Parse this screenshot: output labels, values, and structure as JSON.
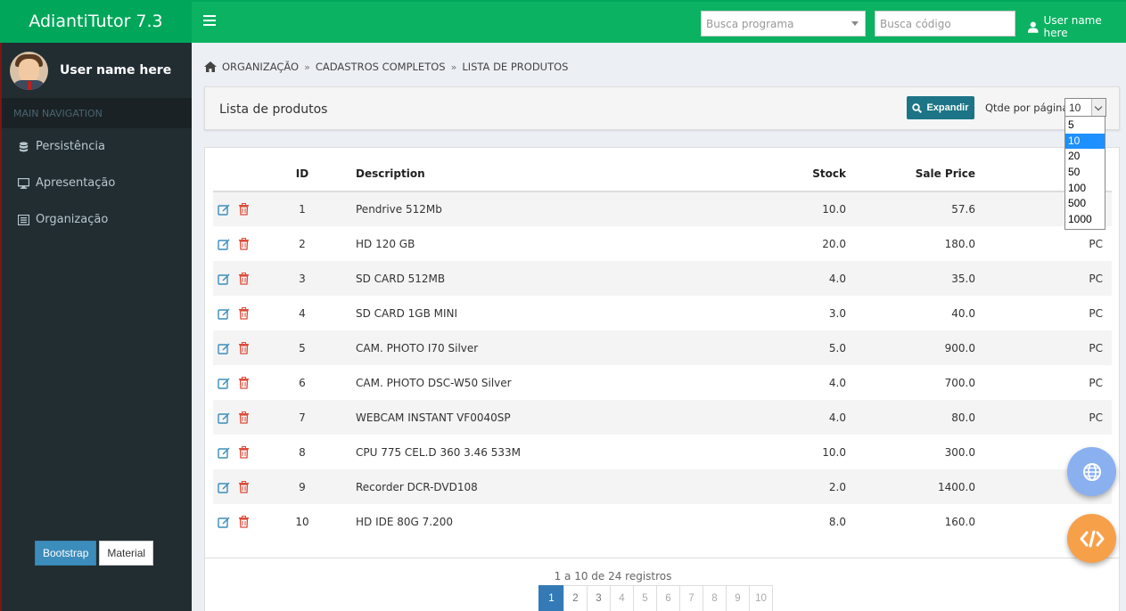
{
  "app": {
    "title": "AdiantiTutor 7.3"
  },
  "navbar": {
    "search_program_placeholder": "Busca programa",
    "search_code_placeholder": "Busca código",
    "user_name": "User name here"
  },
  "sidebar": {
    "user_name": "User name here",
    "nav_header": "MAIN NAVIGATION",
    "items": [
      {
        "label": "Persistência",
        "icon": "database-icon"
      },
      {
        "label": "Apresentação",
        "icon": "monitor-icon"
      },
      {
        "label": "Organização",
        "icon": "list-icon"
      }
    ],
    "theme_buttons": [
      "Bootstrap",
      "Material"
    ]
  },
  "breadcrumb": [
    "ORGANIZAÇÃO",
    "CADASTROS COMPLETOS",
    "LISTA DE PRODUTOS"
  ],
  "panel": {
    "title": "Lista de produtos",
    "expand_label": "Expandir",
    "per_page_label": "Qtde por página",
    "per_page_value": "10",
    "per_page_options": [
      "5",
      "10",
      "20",
      "50",
      "100",
      "500",
      "1000"
    ]
  },
  "table": {
    "columns": [
      "ID",
      "Description",
      "Stock",
      "Sale Price"
    ],
    "rows": [
      {
        "id": "1",
        "description": "Pendrive 512Mb",
        "stock": "10.0",
        "price": "57.6",
        "unit": ""
      },
      {
        "id": "2",
        "description": "HD 120 GB",
        "stock": "20.0",
        "price": "180.0",
        "unit": "PC"
      },
      {
        "id": "3",
        "description": "SD CARD 512MB",
        "stock": "4.0",
        "price": "35.0",
        "unit": "PC"
      },
      {
        "id": "4",
        "description": "SD CARD 1GB MINI",
        "stock": "3.0",
        "price": "40.0",
        "unit": "PC"
      },
      {
        "id": "5",
        "description": "CAM. PHOTO I70 Silver",
        "stock": "5.0",
        "price": "900.0",
        "unit": "PC"
      },
      {
        "id": "6",
        "description": "CAM. PHOTO DSC-W50 Silver",
        "stock": "4.0",
        "price": "700.0",
        "unit": "PC"
      },
      {
        "id": "7",
        "description": "WEBCAM INSTANT VF0040SP",
        "stock": "4.0",
        "price": "80.0",
        "unit": "PC"
      },
      {
        "id": "8",
        "description": "CPU 775 CEL.D 360 3.46 533M",
        "stock": "10.0",
        "price": "300.0",
        "unit": ""
      },
      {
        "id": "9",
        "description": "Recorder DCR-DVD108",
        "stock": "2.0",
        "price": "1400.0",
        "unit": ""
      },
      {
        "id": "10",
        "description": "HD IDE 80G 7.200",
        "stock": "8.0",
        "price": "160.0",
        "unit": ""
      }
    ]
  },
  "pagination": {
    "summary": "1 a 10 de 24 registros",
    "pages": [
      "1",
      "2",
      "3",
      "4",
      "5",
      "6",
      "7",
      "8",
      "9",
      "10"
    ],
    "active": "1"
  },
  "colors": {
    "brand_green": "#00a65a",
    "sidebar_dark": "#222d32",
    "expand_button": "#1c7486",
    "active_page": "#337ab7"
  }
}
